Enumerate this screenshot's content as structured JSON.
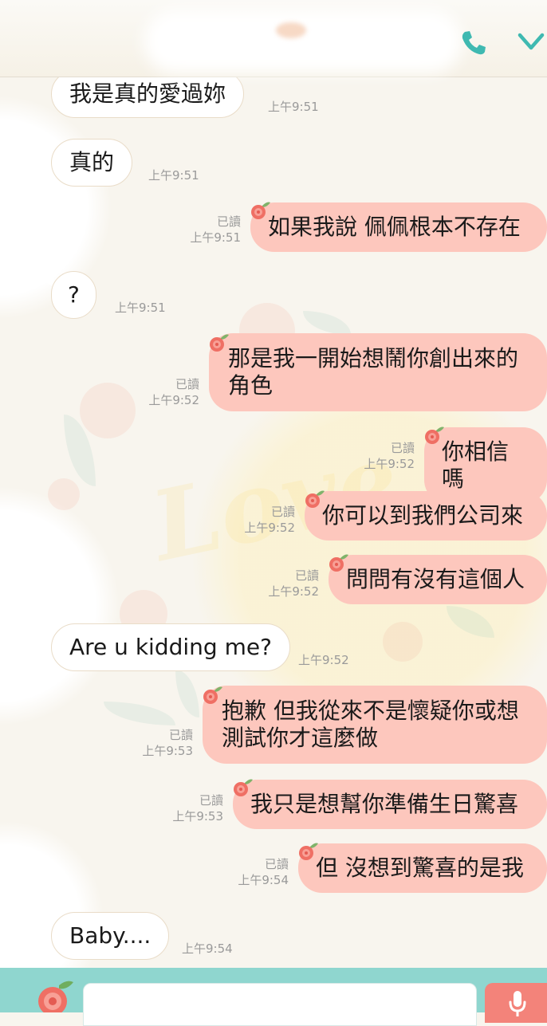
{
  "colors": {
    "incoming_bubble": "#ffffff",
    "outgoing_bubble": "#fdc7bd",
    "meta_text": "#9a9a9a",
    "accent_teal": "#3fb9b1",
    "bottom_bar": "#8fd6cf",
    "mic_button": "#f3837a"
  },
  "header": {
    "call_icon": "phone-icon",
    "collapse_icon": "chevron-down-icon"
  },
  "messages": [
    {
      "direction": "in",
      "text": "我是真的愛過妳",
      "time": "上午9:51"
    },
    {
      "direction": "in",
      "text": "真的",
      "time": "上午9:51"
    },
    {
      "direction": "out",
      "text": "如果我說 佩佩根本不存在",
      "read": "已讀",
      "time": "上午9:51"
    },
    {
      "direction": "in",
      "text": "?",
      "time": "上午9:51"
    },
    {
      "direction": "out",
      "text": "那是我一開始想鬧你創出來的角色",
      "read": "已讀",
      "time": "上午9:52"
    },
    {
      "direction": "out",
      "text": "你相信嗎",
      "read": "已讀",
      "time": "上午9:52"
    },
    {
      "direction": "out",
      "text": "你可以到我們公司來",
      "read": "已讀",
      "time": "上午9:52"
    },
    {
      "direction": "out",
      "text": "問問有沒有這個人",
      "read": "已讀",
      "time": "上午9:52"
    },
    {
      "direction": "in",
      "text": "Are u kidding me?",
      "time": "上午9:52"
    },
    {
      "direction": "out",
      "text": "抱歉 但我從來不是懷疑你或想測試你才這麼做",
      "read": "已讀",
      "time": "上午9:53"
    },
    {
      "direction": "out",
      "text": "我只是想幫你準備生日驚喜",
      "read": "已讀",
      "time": "上午9:53"
    },
    {
      "direction": "out",
      "text": "但 沒想到驚喜的是我",
      "read": "已讀",
      "time": "上午9:54"
    },
    {
      "direction": "in",
      "text": "Baby....",
      "time": "上午9:54"
    }
  ],
  "input": {
    "value": "",
    "placeholder": ""
  },
  "bottom_bar": {
    "sticker_icon": "flower-sticker-icon",
    "voice_icon": "microphone-icon"
  }
}
